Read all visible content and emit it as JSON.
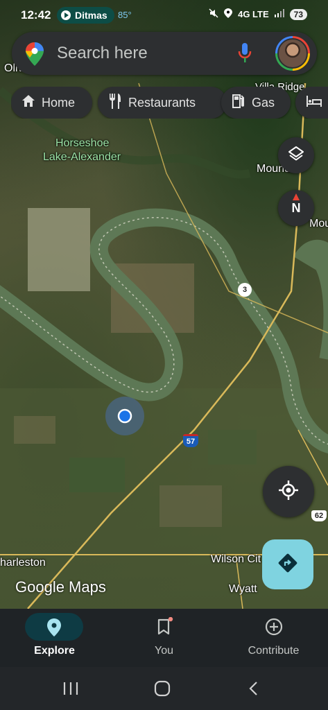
{
  "status_bar": {
    "time": "12:42",
    "chip_label": "Ditmas",
    "temperature": "85°",
    "network": "4G LTE",
    "battery": "73"
  },
  "search": {
    "placeholder": "Search here"
  },
  "chips": [
    {
      "label": "Home",
      "icon": "home-icon"
    },
    {
      "label": "Restaurants",
      "icon": "fork-knife-icon"
    },
    {
      "label": "Gas",
      "icon": "gas-pump-icon"
    },
    {
      "label": "",
      "icon": "hotel-bed-icon"
    }
  ],
  "map": {
    "labels": {
      "olive": "Oliv",
      "villa_ridge": "Villa Ridge",
      "horseshoe_1": "Horseshoe",
      "horseshoe_2": "Lake-Alexander",
      "mounds": "Mounds",
      "mou": "Mou",
      "charleston": "harleston",
      "wilson_city": "Wilson Cit",
      "wyatt": "Wyatt"
    },
    "shields": {
      "route_3": "3",
      "interstate_57": "57",
      "route_62": "62"
    },
    "compass_label": "N",
    "logo": "Google Maps"
  },
  "bottom_nav": {
    "items": [
      {
        "label": "Explore",
        "icon": "location-pin-icon",
        "active": true
      },
      {
        "label": "You",
        "icon": "bookmark-icon",
        "active": false
      },
      {
        "label": "Contribute",
        "icon": "plus-circle-icon",
        "active": false
      }
    ]
  },
  "colors": {
    "accent": "#7fd3e0",
    "surface": "#2d2f31",
    "location_dot": "#1a73e8",
    "river": "#5f7a57"
  }
}
